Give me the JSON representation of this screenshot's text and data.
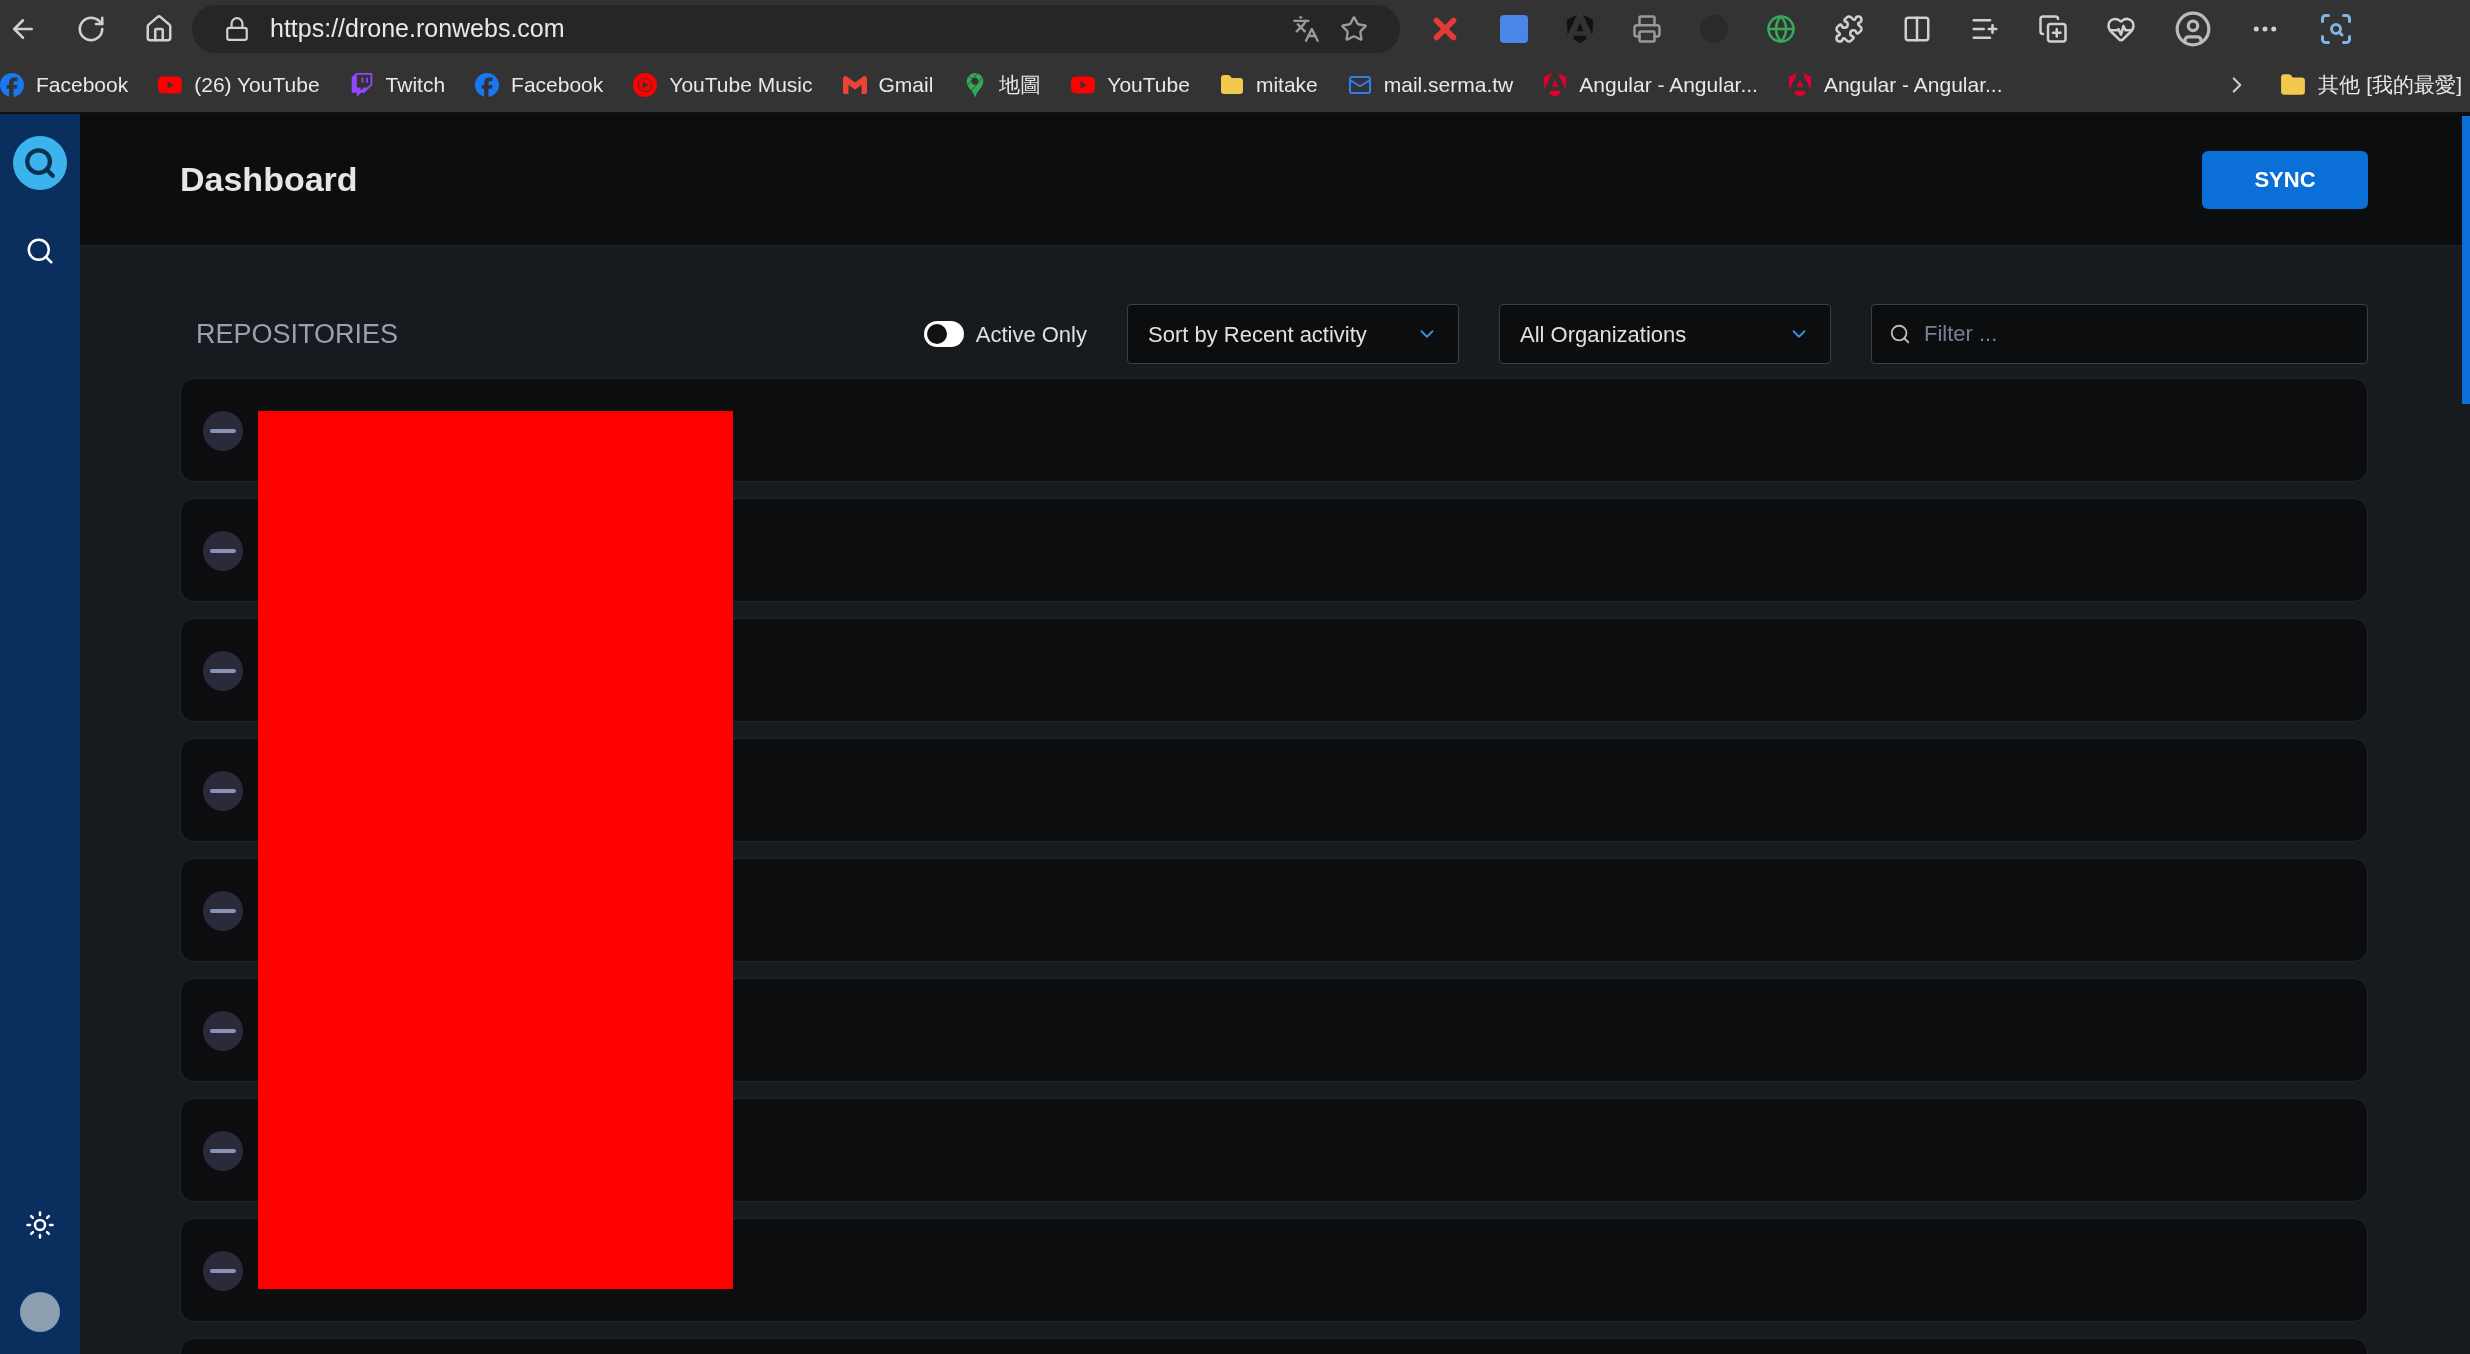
{
  "browser": {
    "url": "https://drone.ronwebs.com",
    "bookmarks": [
      {
        "kind": "facebook",
        "label": "Facebook"
      },
      {
        "kind": "youtube",
        "label": "(26) YouTube"
      },
      {
        "kind": "twitch",
        "label": "Twitch"
      },
      {
        "kind": "facebook",
        "label": "Facebook"
      },
      {
        "kind": "youtube-music",
        "label": "YouTube Music"
      },
      {
        "kind": "gmail",
        "label": "Gmail"
      },
      {
        "kind": "maps",
        "label": "地圖"
      },
      {
        "kind": "youtube",
        "label": "YouTube"
      },
      {
        "kind": "folder",
        "label": "mitake"
      },
      {
        "kind": "mail",
        "label": "mail.serma.tw"
      },
      {
        "kind": "angular",
        "label": "Angular - Angular..."
      },
      {
        "kind": "angular",
        "label": "Angular - Angular..."
      }
    ],
    "other_bookmarks": "其他 [我的最愛]"
  },
  "header": {
    "title": "Dashboard",
    "sync_button": "SYNC"
  },
  "repositories": {
    "title": "REPOSITORIES",
    "active_only": {
      "label": "Active Only",
      "on": false
    },
    "sort": {
      "value": "Sort by Recent activity"
    },
    "organization": {
      "value": "All Organizations"
    },
    "filter": {
      "placeholder": "Filter ..."
    },
    "rows": [
      {
        "kind": "inactive"
      },
      {
        "kind": "inactive"
      },
      {
        "kind": "inactive"
      },
      {
        "kind": "inactive"
      },
      {
        "kind": "inactive"
      },
      {
        "kind": "inactive"
      },
      {
        "kind": "inactive"
      },
      {
        "kind": "inactive"
      },
      {}
    ]
  }
}
